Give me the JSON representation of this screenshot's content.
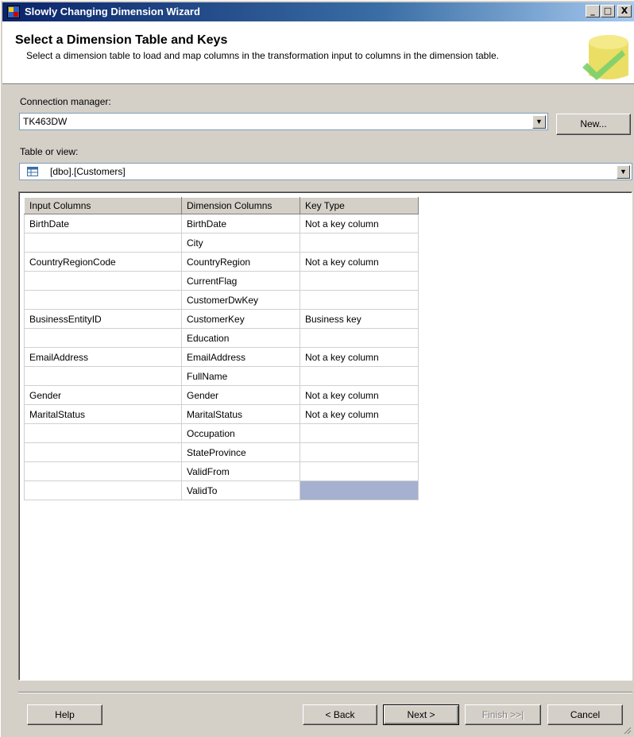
{
  "window": {
    "title": "Slowly Changing Dimension Wizard",
    "controls": {
      "minimize": "_",
      "maximize": "□",
      "close": "X"
    }
  },
  "header": {
    "title": "Select a Dimension Table and Keys",
    "description": "Select a dimension table to load and map columns in the transformation input to columns in the dimension table.",
    "art_icon": "wizard-cylinder-check-icon"
  },
  "connection": {
    "label": "Connection manager:",
    "value": "TK463DW",
    "new_button": "New..."
  },
  "table_or_view": {
    "label": "Table or view:",
    "value": "[dbo].[Customers]",
    "icon": "table-icon"
  },
  "grid": {
    "headers": [
      "Input Columns",
      "Dimension Columns",
      "Key Type"
    ],
    "rows": [
      [
        "BirthDate",
        "BirthDate",
        "Not a key column"
      ],
      [
        "",
        "City",
        ""
      ],
      [
        "CountryRegionCode",
        "CountryRegion",
        "Not a key column"
      ],
      [
        "",
        "CurrentFlag",
        ""
      ],
      [
        "",
        "CustomerDwKey",
        ""
      ],
      [
        "BusinessEntityID",
        "CustomerKey",
        "Business key"
      ],
      [
        "",
        "Education",
        ""
      ],
      [
        "EmailAddress",
        "EmailAddress",
        "Not a key column"
      ],
      [
        "",
        "FullName",
        ""
      ],
      [
        "Gender",
        "Gender",
        "Not a key column"
      ],
      [
        "MaritalStatus",
        "MaritalStatus",
        "Not a key column"
      ],
      [
        "",
        "Occupation",
        ""
      ],
      [
        "",
        "StateProvince",
        ""
      ],
      [
        "",
        "ValidFrom",
        ""
      ],
      [
        "",
        "ValidTo",
        ""
      ]
    ],
    "selected_cell": {
      "row": 14,
      "col": 2
    }
  },
  "footer": {
    "help": "Help",
    "back": "< Back",
    "next": "Next >",
    "finish": "Finish >>|",
    "cancel": "Cancel"
  },
  "colors": {
    "title_bar_start": "#0a246a",
    "title_bar_end": "#a6caf0",
    "dialog_face": "#d4d0c8",
    "selection": "#a6b0d0"
  }
}
